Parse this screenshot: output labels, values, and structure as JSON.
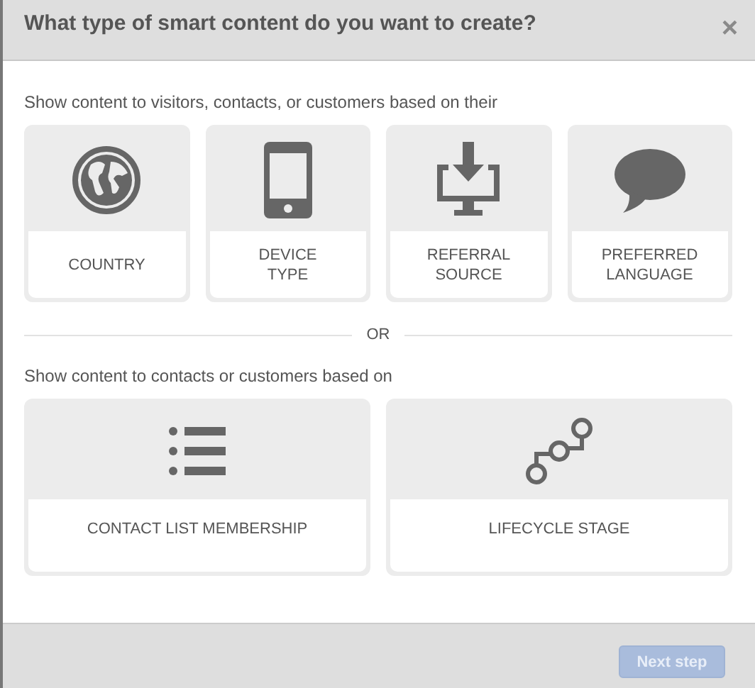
{
  "dialog": {
    "title": "What type of smart content do you want to create?",
    "close": "×"
  },
  "sections": [
    {
      "intro": "Show content to visitors, contacts, or customers based on their",
      "options": [
        {
          "label": "COUNTRY",
          "kind": "globe"
        },
        {
          "label": "DEVICE\nTYPE",
          "kind": "phone"
        },
        {
          "label": "REFERRAL\nSOURCE",
          "kind": "download"
        },
        {
          "label": "PREFERRED\nLANGUAGE",
          "kind": "speech"
        }
      ]
    },
    {
      "intro": "Show content to contacts or customers based on",
      "options": [
        {
          "label": "CONTACT LIST MEMBERSHIP",
          "kind": "list"
        },
        {
          "label": "LIFECYCLE STAGE",
          "kind": "stages"
        }
      ]
    }
  ],
  "divider": "OR",
  "footer": {
    "button": {
      "label": "Next step",
      "disabled": true
    }
  }
}
